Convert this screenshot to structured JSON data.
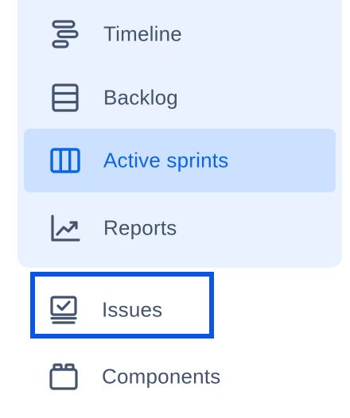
{
  "sidebar": {
    "items": [
      {
        "label": "Timeline",
        "icon": "timeline-icon",
        "active": false
      },
      {
        "label": "Backlog",
        "icon": "backlog-icon",
        "active": false
      },
      {
        "label": "Active sprints",
        "icon": "board-columns-icon",
        "active": true
      },
      {
        "label": "Reports",
        "icon": "chart-trend-icon",
        "active": false
      },
      {
        "label": "Issues",
        "icon": "issues-tray-icon",
        "active": false,
        "focused": true
      },
      {
        "label": "Components",
        "icon": "component-icon",
        "active": false
      }
    ]
  },
  "colors": {
    "panel_bg": "#e9f2fe",
    "active_bg": "#cce0ff",
    "active_text": "#0c66e4",
    "text": "#44546f",
    "focus_ring": "#0c55e4"
  }
}
